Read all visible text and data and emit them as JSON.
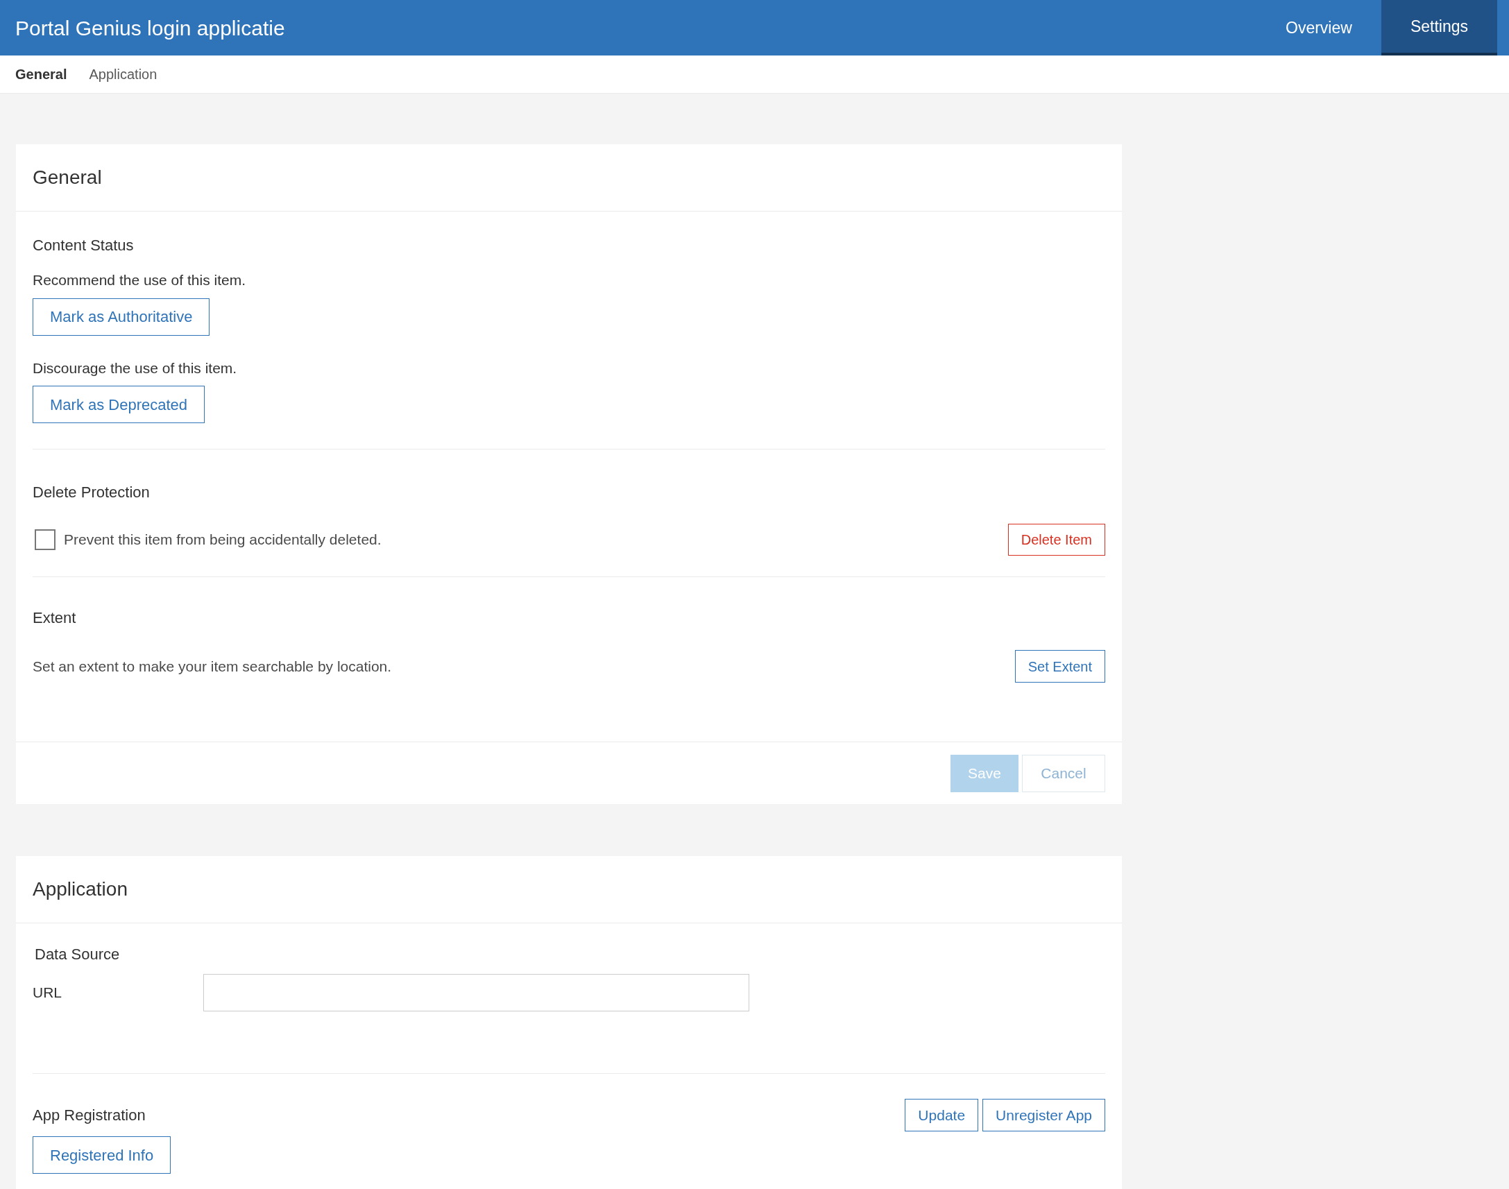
{
  "header": {
    "title": "Portal Genius login applicatie",
    "nav": [
      {
        "label": "Overview",
        "selected": false
      },
      {
        "label": "Settings",
        "selected": true
      }
    ]
  },
  "subnav": [
    {
      "label": "General",
      "selected": true
    },
    {
      "label": "Application",
      "selected": false
    }
  ],
  "general": {
    "title": "General",
    "content_status": {
      "heading": "Content Status",
      "items": [
        {
          "text": "Recommend the use of this item.",
          "button": "Mark as Authoritative"
        },
        {
          "text": "Discourage the use of this item.",
          "button": "Mark as Deprecated"
        }
      ]
    },
    "delete_protection": {
      "heading": "Delete Protection",
      "checkbox": {
        "label": "Prevent this item from being accidentally deleted.",
        "checked": false
      },
      "button": "Delete Item"
    },
    "extent": {
      "heading": "Extent",
      "text": "Set an extent to make your item searchable by location.",
      "button": "Set Extent"
    },
    "footer": [
      {
        "label": "Save",
        "kind": "primary",
        "disabled": true
      },
      {
        "label": "Cancel",
        "kind": "secondary",
        "disabled": true
      }
    ]
  },
  "application": {
    "title": "Application",
    "data_source": {
      "heading": "Data Source",
      "url_label": "URL"
    },
    "app_registration": {
      "heading": "App Registration",
      "buttons": [
        "Update",
        "Unregister App"
      ],
      "info_button": "Registered Info"
    }
  }
}
